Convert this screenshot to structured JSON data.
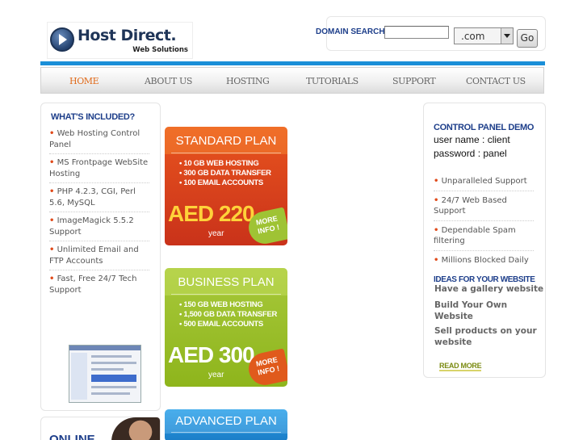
{
  "logo": {
    "title": "Host Direct.",
    "subtitle": "Web Solutions",
    "icon": "arrow-circle-icon"
  },
  "domain_search": {
    "label": "DOMAIN SEARCH",
    "input_value": "",
    "tld_selected": ".com",
    "go_label": "Go"
  },
  "nav": {
    "items": [
      {
        "label": "HOME",
        "active": true
      },
      {
        "label": "ABOUT US"
      },
      {
        "label": "HOSTING"
      },
      {
        "label": "TUTORIALS"
      },
      {
        "label": "SUPPORT"
      },
      {
        "label": "CONTACT US"
      }
    ]
  },
  "included": {
    "title": "WHAT'S INCLUDED?",
    "items": [
      "Web Hosting Control Panel",
      "MS Frontpage WebSite Hosting",
      "PHP 4.2.3, CGI, Perl 5.6, MySQL",
      "ImageMagick 5.5.2 Support",
      "Unlimited Email and FTP Accounts",
      "Fast, Free 24/7 Tech Support"
    ],
    "bullet": "•"
  },
  "online": {
    "text": "ONLINE"
  },
  "plans": [
    {
      "name": "STANDARD PLAN",
      "features": [
        "• 10 GB WEB HOSTING",
        "• 300 GB DATA TRANSFER",
        "• 100 EMAIL ACCOUNTS"
      ],
      "price": "AED 220",
      "period": "year",
      "more": "MORE INFO !"
    },
    {
      "name": "BUSINESS PLAN",
      "features": [
        "• 150 GB WEB HOSTING",
        "• 1,500 GB DATA TRANSFER",
        "• 500 EMAIL ACCOUNTS"
      ],
      "price": "AED 300",
      "period": "year",
      "more": "MORE INFO !"
    },
    {
      "name": "ADVANCED PLAN"
    }
  ],
  "control_panel": {
    "title": "CONTROL PANEL DEMO",
    "username_line": "user name : client",
    "password_line": "password : panel",
    "benefits": [
      "Unparalleled Support",
      "24/7 Web Based Support",
      "Dependable Spam filtering",
      "Millions Blocked Daily"
    ]
  },
  "ideas": {
    "title": "IDEAS FOR YOUR WEBSITE",
    "items": [
      "Have a gallery website",
      "Build Your Own Website",
      "Sell products on your website"
    ],
    "read_more": "READ MORE"
  },
  "colors": {
    "accent_blue": "#1a8fd8",
    "heading_blue": "#1d3e8a",
    "nav_active": "#e06a1a",
    "standard_plan": "#d9431c",
    "business_plan": "#9cbf2a",
    "advanced_plan": "#2490dc"
  }
}
